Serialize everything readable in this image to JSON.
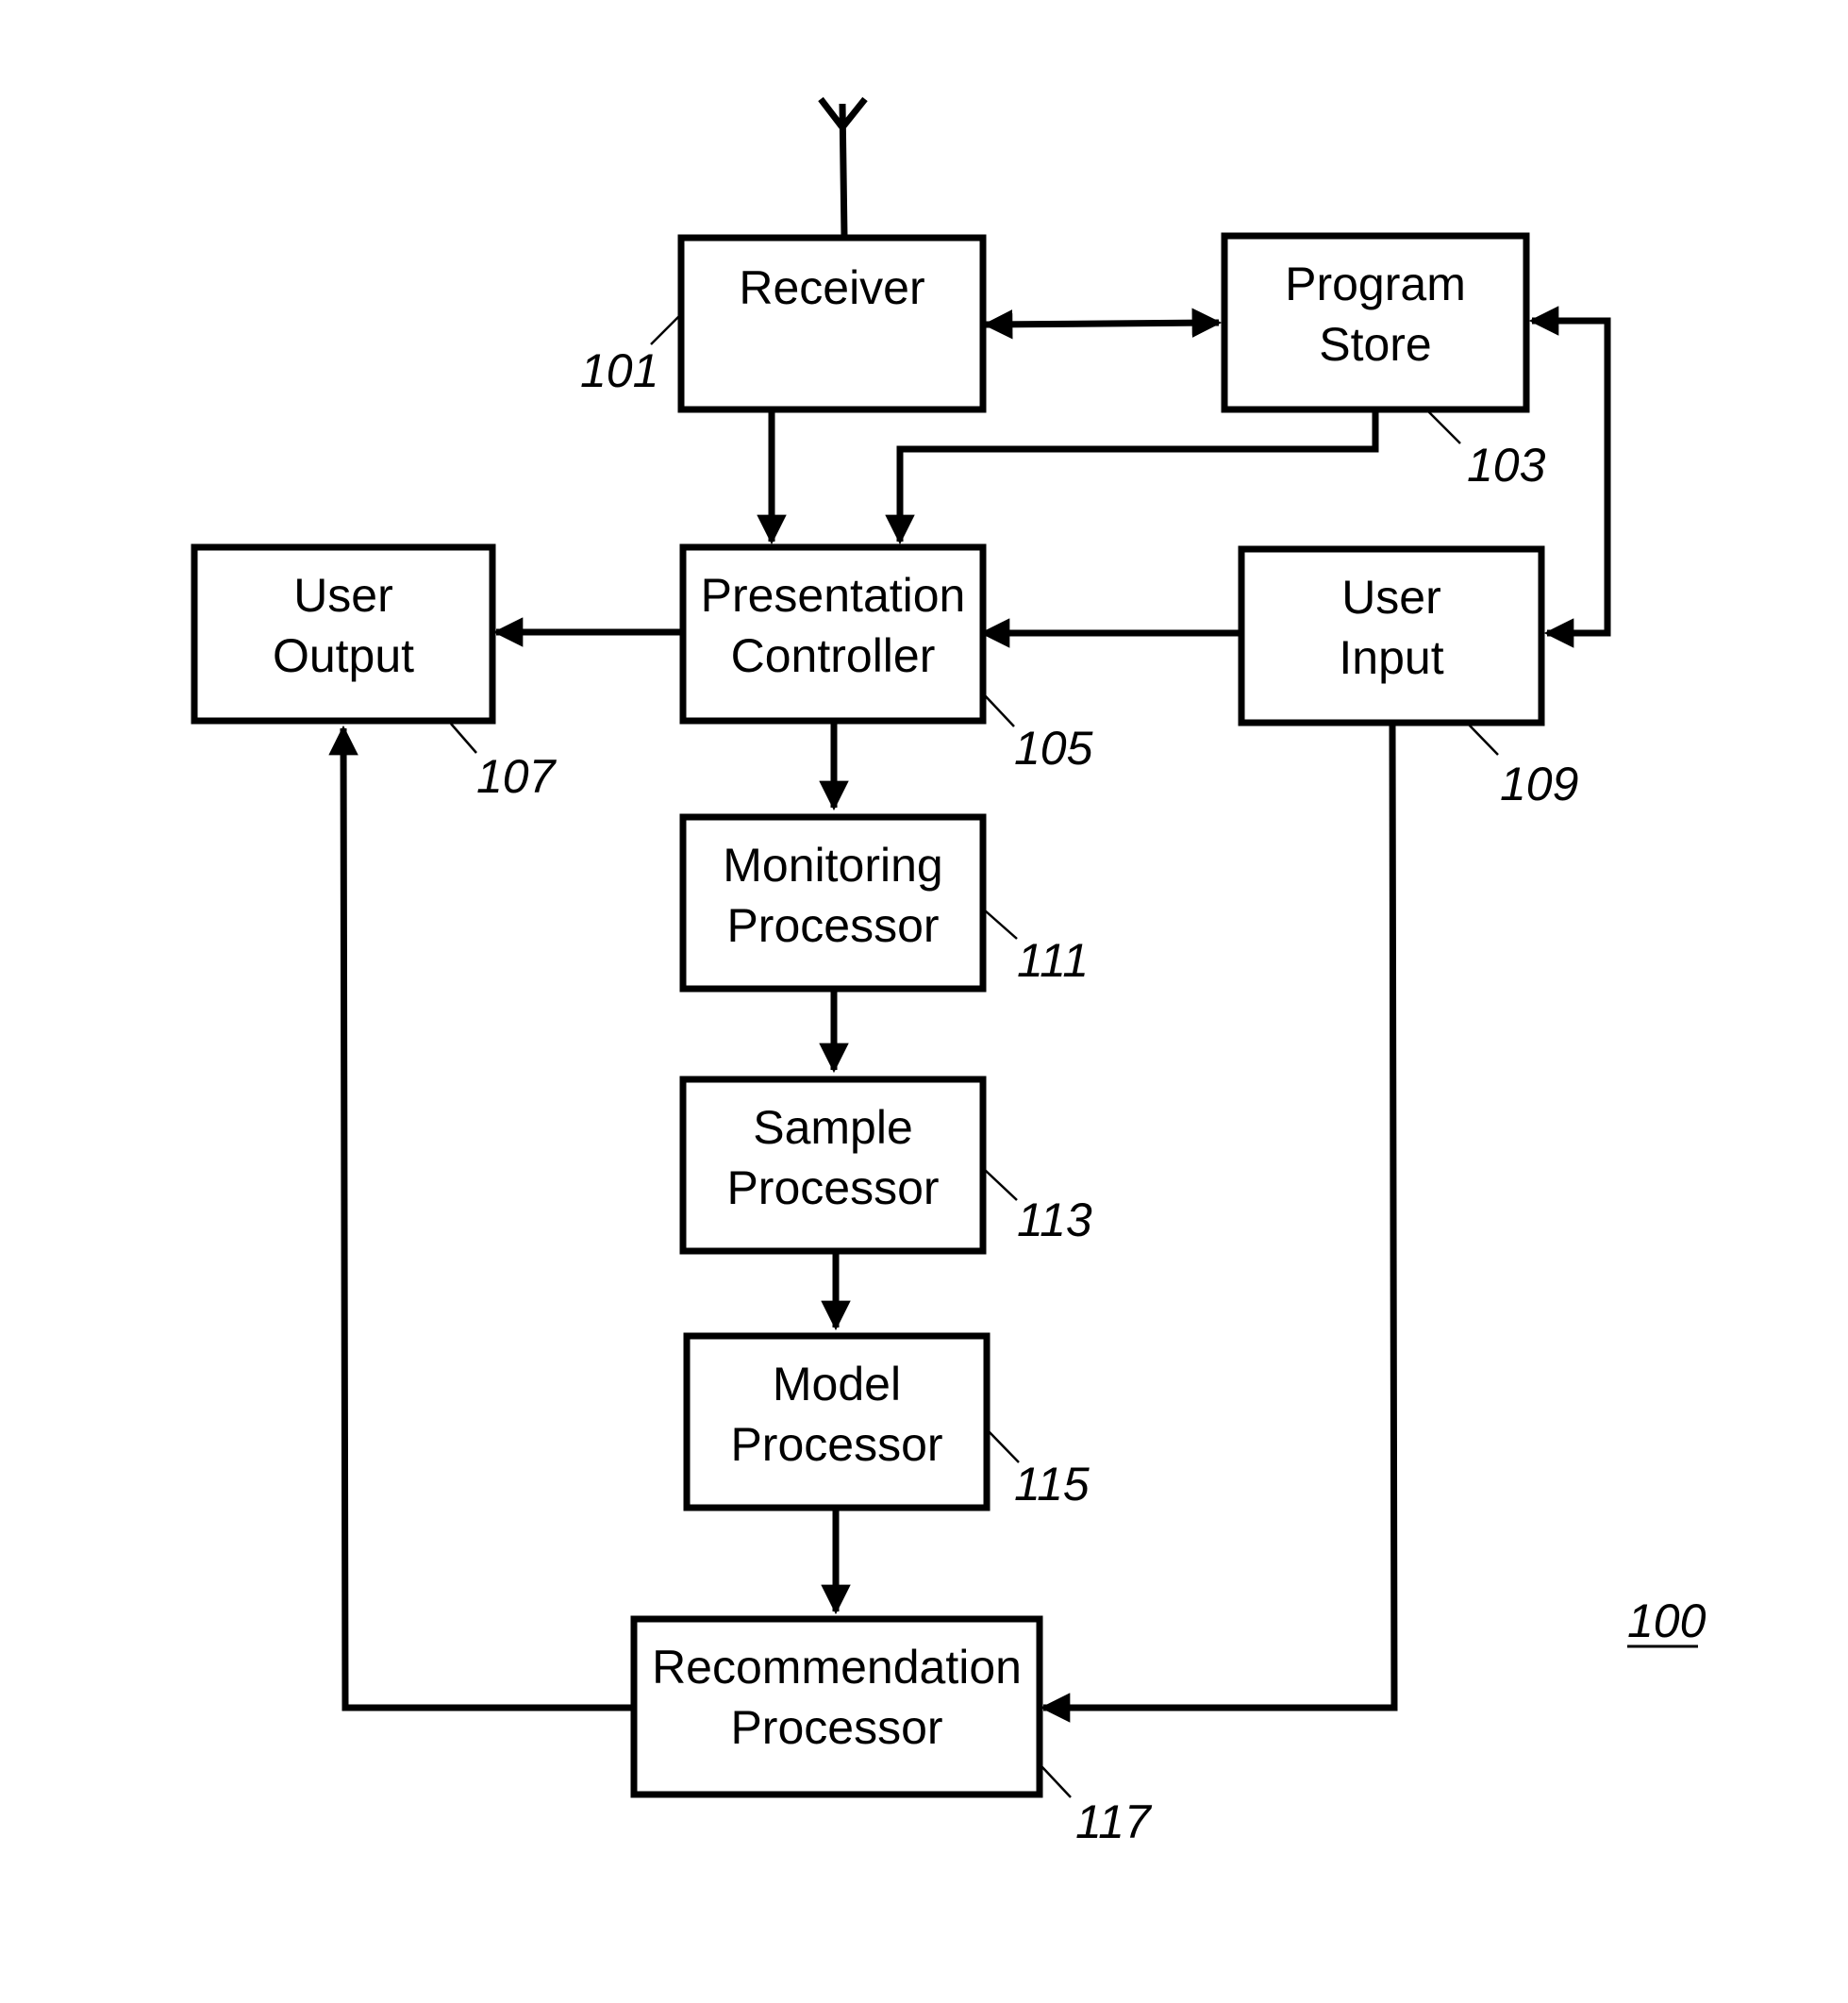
{
  "figure_ref": "100",
  "blocks": [
    {
      "id": "receiver",
      "lines": [
        "Receiver",
        ""
      ],
      "ref": "101"
    },
    {
      "id": "program-store",
      "lines": [
        "Program",
        "Store"
      ],
      "ref": "103"
    },
    {
      "id": "presentation-controller",
      "lines": [
        "Presentation",
        "Controller"
      ],
      "ref": "105"
    },
    {
      "id": "user-output",
      "lines": [
        "User",
        "Output"
      ],
      "ref": "107"
    },
    {
      "id": "user-input",
      "lines": [
        "User",
        "Input"
      ],
      "ref": "109"
    },
    {
      "id": "monitoring-processor",
      "lines": [
        "Monitoring",
        "Processor"
      ],
      "ref": "111"
    },
    {
      "id": "sample-processor",
      "lines": [
        "Sample",
        "Processor"
      ],
      "ref": "113"
    },
    {
      "id": "model-processor",
      "lines": [
        "Model",
        "Processor"
      ],
      "ref": "115"
    },
    {
      "id": "recommendation-processor",
      "lines": [
        "Recommendation",
        "Processor"
      ],
      "ref": "117"
    }
  ],
  "connections": [
    {
      "from": "antenna",
      "to": "receiver"
    },
    {
      "from": "receiver",
      "to": "program-store",
      "bidirectional": true
    },
    {
      "from": "receiver",
      "to": "presentation-controller"
    },
    {
      "from": "program-store",
      "to": "presentation-controller"
    },
    {
      "from": "user-input",
      "to": "program-store",
      "bidirectional": true
    },
    {
      "from": "user-input",
      "to": "presentation-controller"
    },
    {
      "from": "presentation-controller",
      "to": "user-output"
    },
    {
      "from": "presentation-controller",
      "to": "monitoring-processor"
    },
    {
      "from": "monitoring-processor",
      "to": "sample-processor"
    },
    {
      "from": "sample-processor",
      "to": "model-processor"
    },
    {
      "from": "model-processor",
      "to": "recommendation-processor"
    },
    {
      "from": "user-input",
      "to": "recommendation-processor"
    },
    {
      "from": "recommendation-processor",
      "to": "user-output"
    }
  ]
}
